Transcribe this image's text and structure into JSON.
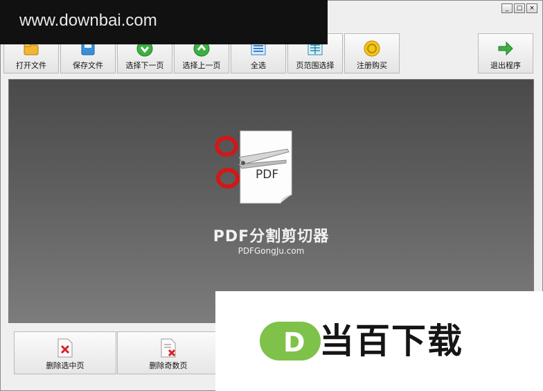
{
  "watermark_top": {
    "text": "www.downbai.com"
  },
  "window_controls": {
    "minimize": "_",
    "maximize": "□",
    "close": "×"
  },
  "toolbar": {
    "buttons": [
      {
        "label": "打开文件",
        "icon": "open-file-icon"
      },
      {
        "label": "保存文件",
        "icon": "save-file-icon"
      },
      {
        "label": "选择下一页",
        "icon": "next-page-icon"
      },
      {
        "label": "选择上一页",
        "icon": "prev-page-icon"
      },
      {
        "label": "全选",
        "icon": "select-all-icon"
      },
      {
        "label": "页范围选择",
        "icon": "page-range-icon"
      },
      {
        "label": "注册购买",
        "icon": "register-icon"
      },
      {
        "label": "退出程序",
        "icon": "exit-icon"
      }
    ]
  },
  "main": {
    "logo_text": "PDF",
    "title": "PDF分割剪切器",
    "url": "PDFGongJu.com"
  },
  "bottom": {
    "buttons": [
      {
        "label": "删除选中页",
        "icon": "delete-selected-icon"
      },
      {
        "label": "删除奇数页",
        "icon": "delete-odd-icon"
      }
    ]
  },
  "watermark_bottom": {
    "text": "当百下载",
    "logo_letter": "D"
  }
}
